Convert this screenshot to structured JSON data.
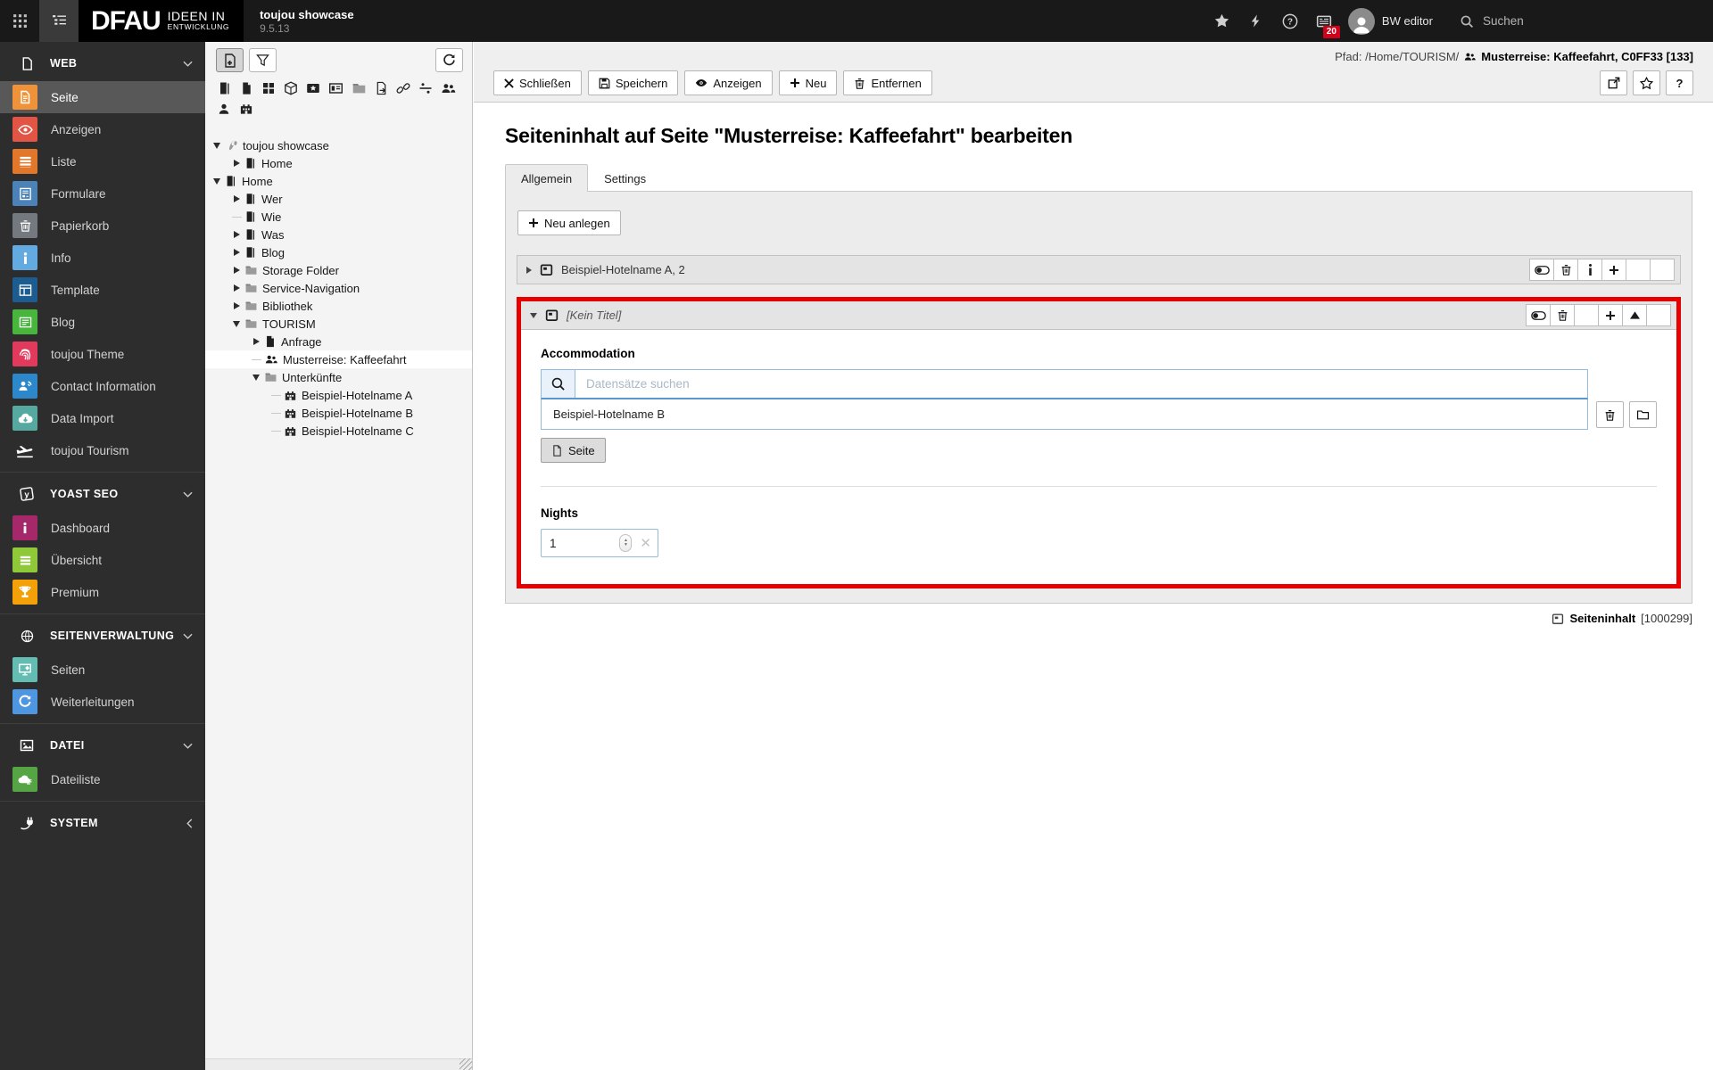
{
  "topbar": {
    "brand": {
      "logo": "DFAU",
      "claim_line1": "IDEEN IN",
      "claim_line2": "ENTWICKLUNG",
      "site_title": "toujou showcase",
      "version": "9.5.13"
    },
    "notification_count": "20",
    "user_name": "BW editor",
    "search_label": "Suchen",
    "icons": [
      "modules-grid",
      "pagetree-toggle",
      "bookmark-star",
      "clear-cache-bolt",
      "help",
      "notifications",
      "avatar",
      "search"
    ],
    "badge_color": "#d0021b"
  },
  "sidebar": {
    "sections": [
      {
        "label": "WEB",
        "icon": "document-section-icon",
        "collapsed": false,
        "items": [
          {
            "label": "Seite",
            "color": "#f0923a",
            "active": true
          },
          {
            "label": "Anzeigen",
            "color": "#e25443",
            "active": false
          },
          {
            "label": "Liste",
            "color": "#e0772a",
            "active": false
          },
          {
            "label": "Formulare",
            "color": "#4b82b8",
            "active": false
          },
          {
            "label": "Papierkorb",
            "color": "#73797e",
            "active": false
          },
          {
            "label": "Info",
            "color": "#62aadf",
            "active": false
          },
          {
            "label": "Template",
            "color": "#1d5c90",
            "active": false
          },
          {
            "label": "Blog",
            "color": "#48b53c",
            "active": false
          },
          {
            "label": "toujou Theme",
            "color": "#e23a5d",
            "active": false
          },
          {
            "label": "Contact Information",
            "color": "#2d87cb",
            "active": false
          },
          {
            "label": "Data Import",
            "color": "#55a9a1",
            "active": false
          },
          {
            "label": "toujou Tourism",
            "color": "",
            "active": false
          }
        ]
      },
      {
        "label": "YOAST SEO",
        "icon": "yoast-icon",
        "collapsed": false,
        "items": [
          {
            "label": "Dashboard",
            "color": "#a4286a",
            "active": false
          },
          {
            "label": "Übersicht",
            "color": "#8fc93a",
            "active": false
          },
          {
            "label": "Premium",
            "color": "#f3a009",
            "active": false
          }
        ]
      },
      {
        "label": "SEITENVERWALTUNG",
        "icon": "globe-icon",
        "collapsed": false,
        "items": [
          {
            "label": "Seiten",
            "color": "#63bdb2",
            "active": false
          },
          {
            "label": "Weiterleitungen",
            "color": "#4e96e0",
            "active": false
          }
        ]
      },
      {
        "label": "DATEI",
        "icon": "image-icon",
        "collapsed": false,
        "items": [
          {
            "label": "Dateiliste",
            "color": "#55a545",
            "active": false
          }
        ]
      },
      {
        "label": "SYSTEM",
        "icon": "plug-icon",
        "collapsed": true,
        "items": []
      }
    ]
  },
  "pagetree": {
    "toolbar_icons": [
      "new-page",
      "filter",
      "refresh"
    ],
    "drag_icons": [
      "page-standard",
      "page-plain",
      "backend-layout",
      "content-box",
      "bookmark-plate",
      "record-card",
      "folder",
      "page-external",
      "link",
      "divider",
      "userfolder"
    ],
    "drag_icons_row2": [
      "user-record",
      "hotel-record"
    ],
    "nodes": [
      {
        "label": "toujou showcase",
        "icon": "typo3-root",
        "depth": 0,
        "expander": "open",
        "selected": false
      },
      {
        "label": "Home",
        "icon": "page",
        "depth": 1,
        "expander": "closed",
        "selected": false
      },
      {
        "label": "Home",
        "icon": "page",
        "depth": 0,
        "expander": "open",
        "selected": false
      },
      {
        "label": "Wer",
        "icon": "page",
        "depth": 1,
        "expander": "closed",
        "selected": false
      },
      {
        "label": "Wie",
        "icon": "page",
        "depth": 1,
        "expander": "leaf",
        "selected": false
      },
      {
        "label": "Was",
        "icon": "page",
        "depth": 1,
        "expander": "closed",
        "selected": false
      },
      {
        "label": "Blog",
        "icon": "page",
        "depth": 1,
        "expander": "closed",
        "selected": false
      },
      {
        "label": "Storage Folder",
        "icon": "folder",
        "depth": 1,
        "expander": "closed",
        "selected": false
      },
      {
        "label": "Service-Navigation",
        "icon": "folder",
        "depth": 1,
        "expander": "closed",
        "selected": false
      },
      {
        "label": "Bibliothek",
        "icon": "folder",
        "depth": 1,
        "expander": "closed",
        "selected": false
      },
      {
        "label": "TOURISM",
        "icon": "folder",
        "depth": 1,
        "expander": "open",
        "selected": false
      },
      {
        "label": "Anfrage",
        "icon": "sheet",
        "depth": 2,
        "expander": "closed",
        "selected": false
      },
      {
        "label": "Musterreise: Kaffeefahrt",
        "icon": "users",
        "depth": 2,
        "expander": "leaf",
        "selected": true
      },
      {
        "label": "Unterkünfte",
        "icon": "folder",
        "depth": 2,
        "expander": "open",
        "selected": false
      },
      {
        "label": "Beispiel-Hotelname A",
        "icon": "hotel",
        "depth": 3,
        "expander": "leaf",
        "selected": false
      },
      {
        "label": "Beispiel-Hotelname B",
        "icon": "hotel",
        "depth": 3,
        "expander": "leaf",
        "selected": false
      },
      {
        "label": "Beispiel-Hotelname C",
        "icon": "hotel",
        "depth": 3,
        "expander": "leaf",
        "selected": false
      }
    ]
  },
  "docheader": {
    "path_prefix": "Pfad: /Home/TOURISM/",
    "path_record": "Musterreise: Kaffeefahrt, C0FF33 [133]",
    "buttons": {
      "close": "Schließen",
      "save": "Speichern",
      "view": "Anzeigen",
      "new": "Neu",
      "delete": "Entfernen"
    },
    "mini_buttons": [
      "open-in-window",
      "bookmark",
      "help"
    ],
    "help_label": "?"
  },
  "main": {
    "heading": "Seiteninhalt auf Seite \"Musterreise: Kaffeefahrt\" bearbeiten",
    "tabs": [
      {
        "label": "Allgemein",
        "active": true
      },
      {
        "label": "Settings",
        "active": false
      }
    ],
    "new_button_label": "Neu anlegen",
    "highlight_color": "#e60000",
    "panels": [
      {
        "title": "Beispiel-Hotelname A, 2",
        "collapsed": true,
        "buttons": [
          "visibility-toggle",
          "trash",
          "info",
          "plus",
          "",
          ""
        ]
      },
      {
        "title": "[Kein Titel]",
        "collapsed": false,
        "buttons": [
          "visibility-toggle",
          "trash",
          "",
          "plus",
          "move-up",
          ""
        ]
      }
    ],
    "accommodation": {
      "label": "Accommodation",
      "search_placeholder": "Datensätze suchen",
      "selected_item": "Beispiel-Hotelname B",
      "side_buttons": [
        "remove",
        "browse-folder"
      ],
      "page_button_label": "Seite"
    },
    "nights": {
      "label": "Nights",
      "value": "1"
    },
    "record_footer": {
      "type": "Seiteninhalt",
      "uid": "[1000299]"
    }
  }
}
